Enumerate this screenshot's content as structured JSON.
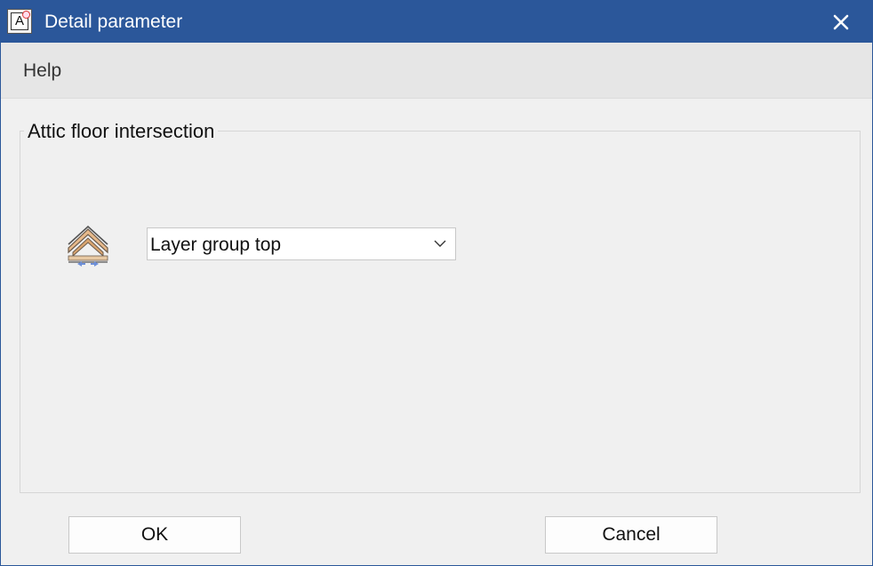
{
  "window": {
    "title": "Detail parameter",
    "app_icon_letter": "A",
    "accent_color": "#2b579a"
  },
  "menu": {
    "items": [
      {
        "label": "Help"
      }
    ]
  },
  "group": {
    "title": "Attic floor intersection",
    "detail_icon": "roof-layers-icon",
    "dropdown": {
      "selected": "Layer group top"
    }
  },
  "buttons": {
    "ok_label": "OK",
    "cancel_label": "Cancel"
  }
}
